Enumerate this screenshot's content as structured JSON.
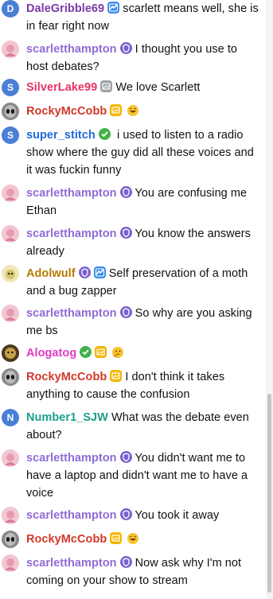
{
  "colors": {
    "dale": "#7a3aa8",
    "scarlett": "#8f6cd6",
    "silverlake": "#e63566",
    "rocky": "#d2382a",
    "stitch": "#1e6ad6",
    "adolwulf": "#b57a00",
    "alogatog": "#e03ac3",
    "number1": "#1a9e8c"
  },
  "messages": [
    {
      "user": "DaleGribble69",
      "avatar_letter": "D",
      "badges": [
        "twitch-prime-icon"
      ],
      "text": "scarlett means well, she is in fear right now"
    },
    {
      "user": "scarletthampton",
      "badges": [
        "moderator-shield-icon"
      ],
      "text": "I thought you use to host debates?"
    },
    {
      "user": "SilverLake99",
      "avatar_letter": "S",
      "badges": [
        "gray-crown-icon"
      ],
      "text": "We love Scarlett"
    },
    {
      "user": "RockyMcCobb",
      "badges": [
        "gold-crown-icon"
      ],
      "emote": "laughing-emoji-icon",
      "text": ""
    },
    {
      "user": "super_stitch",
      "avatar_letter": "S",
      "badges": [
        "verified-check-icon"
      ],
      "text": "i used to listen to a radio show where the guy did all these voices and it was fuckin funny"
    },
    {
      "user": "scarletthampton",
      "badges": [
        "moderator-shield-icon"
      ],
      "text": "You are confusing me Ethan"
    },
    {
      "user": "scarletthampton",
      "badges": [
        "moderator-shield-icon"
      ],
      "text": "You know the answers already"
    },
    {
      "user": "Adolwulf",
      "badges": [
        "moderator-shield-icon",
        "twitch-prime-icon"
      ],
      "text": "Self preservation of a moth and a bug zapper"
    },
    {
      "user": "scarletthampton",
      "badges": [
        "moderator-shield-icon"
      ],
      "text": "So why are you asking me bs"
    },
    {
      "user": "Alogatog",
      "badges": [
        "verified-check-icon",
        "gold-crown-icon"
      ],
      "emote": "thinking-emoji-icon",
      "text": ""
    },
    {
      "user": "RockyMcCobb",
      "badges": [
        "gold-crown-icon"
      ],
      "text": "I don't think it takes anything to cause the confusion"
    },
    {
      "user": "Number1_SJW",
      "avatar_letter": "N",
      "badges": [],
      "text": "What was the debate even about?"
    },
    {
      "user": "scarletthampton",
      "badges": [
        "moderator-shield-icon"
      ],
      "text": "You didn't want me to have a laptop and didn't want me to have a voice"
    },
    {
      "user": "scarletthampton",
      "badges": [
        "moderator-shield-icon"
      ],
      "text": "You took it away"
    },
    {
      "user": "RockyMcCobb",
      "badges": [
        "gold-crown-icon"
      ],
      "emote": "laughing-emoji-icon",
      "text": ""
    },
    {
      "user": "scarletthampton",
      "badges": [
        "moderator-shield-icon"
      ],
      "text": "Now ask why I'm not coming on your show to stream"
    }
  ]
}
